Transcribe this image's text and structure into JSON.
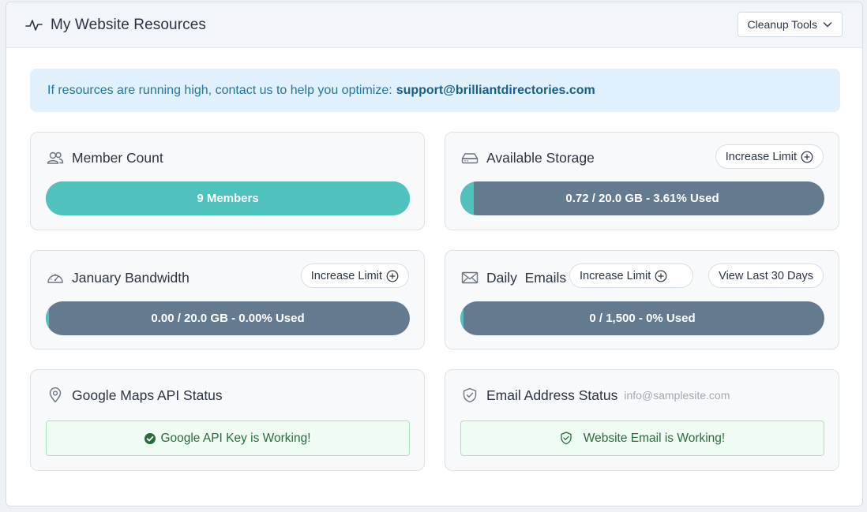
{
  "header": {
    "title": "My Website Resources",
    "cleanup_label": "Cleanup Tools"
  },
  "alert": {
    "text": "If resources are running high, contact us to help you optimize:",
    "email": "support@brilliantdirectories.com"
  },
  "cards": {
    "member_count": {
      "title": "Member Count",
      "bar_label": "9 Members",
      "fill_percent": 100
    },
    "storage": {
      "title": "Available Storage",
      "increase_label": "Increase Limit",
      "bar_label": "0.72 / 20.0 GB - 3.61% Used",
      "fill_percent": 3.61
    },
    "bandwidth": {
      "title": "January Bandwidth",
      "increase_label": "Increase Limit",
      "bar_label": "0.00 / 20.0 GB - 0.00% Used",
      "fill_percent": 0
    },
    "emails": {
      "title": "Daily  Emails",
      "increase_label": "Increase Limit",
      "view_label": "View Last 30 Days",
      "bar_label": "0 / 1,500 - 0% Used",
      "fill_percent": 0
    },
    "maps": {
      "title": "Google Maps API Status",
      "status_text": "Google API Key is Working!"
    },
    "email_status": {
      "title": "Email Address Status",
      "address": "info@samplesite.com",
      "status_text": "Website Email is Working!"
    }
  },
  "colors": {
    "accent_teal": "#4fc2bd",
    "bar_slate": "#647a8e",
    "success_green": "#2a6b3e",
    "info_blue": "#29739e"
  },
  "icons": [
    "activity-icon",
    "chevron-down-icon",
    "users-icon",
    "hard-drive-icon",
    "gauge-icon",
    "mail-icon",
    "map-pin-icon",
    "shield-check-icon",
    "check-circle-icon",
    "plus-circle-icon"
  ]
}
